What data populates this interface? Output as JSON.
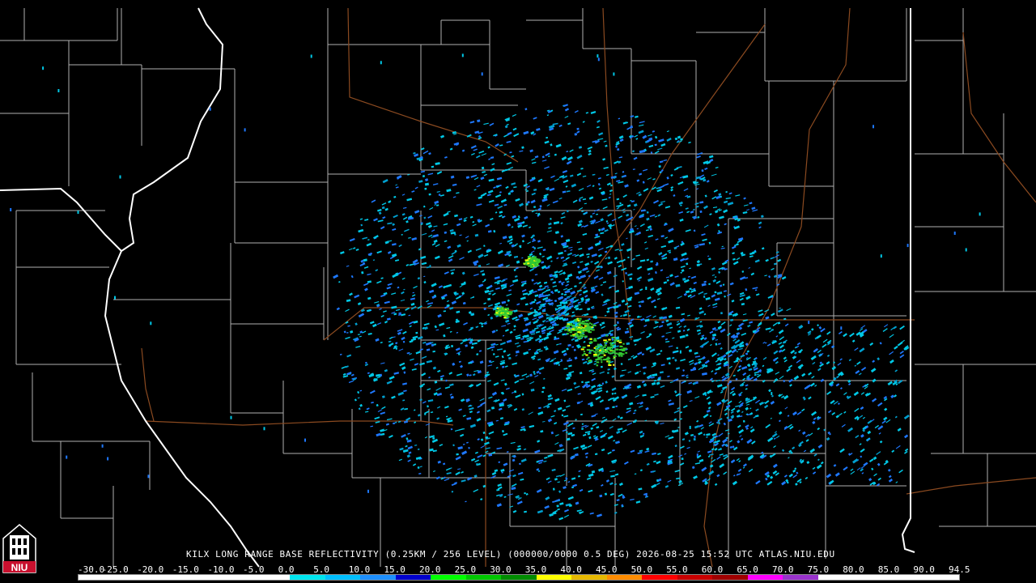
{
  "title": "KILX LONG RANGE BASE REFLECTIVITY (0.25KM / 256 LEVEL) (000000/0000 0.5 DEG) 2026-08-25 15:52 UTC  ATLAS.NIU.EDU",
  "logo": {
    "text": "NIU",
    "icon": "university-tower-icon"
  },
  "legend": {
    "labels": [
      "-30.0",
      "-25.0",
      "-20.0",
      "-15.0",
      "-10.0",
      "-5.0",
      "0.0",
      "5.0",
      "10.0",
      "15.0",
      "20.0",
      "25.0",
      "30.0",
      "35.0",
      "40.0",
      "45.0",
      "50.0",
      "55.0",
      "60.0",
      "65.0",
      "70.0",
      "75.0",
      "80.0",
      "85.0",
      "90.0",
      "94.5"
    ],
    "colors": [
      "#ffffff",
      "#ffffff",
      "#ffffff",
      "#ffffff",
      "#ffffff",
      "#ffffff",
      "#00e5ee",
      "#00bfff",
      "#1e90ff",
      "#0000cd",
      "#00ff00",
      "#00c800",
      "#008c00",
      "#ffff00",
      "#e6b800",
      "#ff8c00",
      "#ff0000",
      "#c80000",
      "#a00000",
      "#ff00ff",
      "#9932cc",
      "#ffffff",
      "#ffffff",
      "#ffffff",
      "#ffffff"
    ]
  },
  "colors": {
    "county_lines": "#b4b4b4",
    "state_lines": "#ffffff",
    "highways": "#8b4513",
    "echo_light": "#00c8e6",
    "echo_mid": "#1e78ff",
    "echo_strong": "#32c832",
    "echo_peak": "#ffff00"
  }
}
